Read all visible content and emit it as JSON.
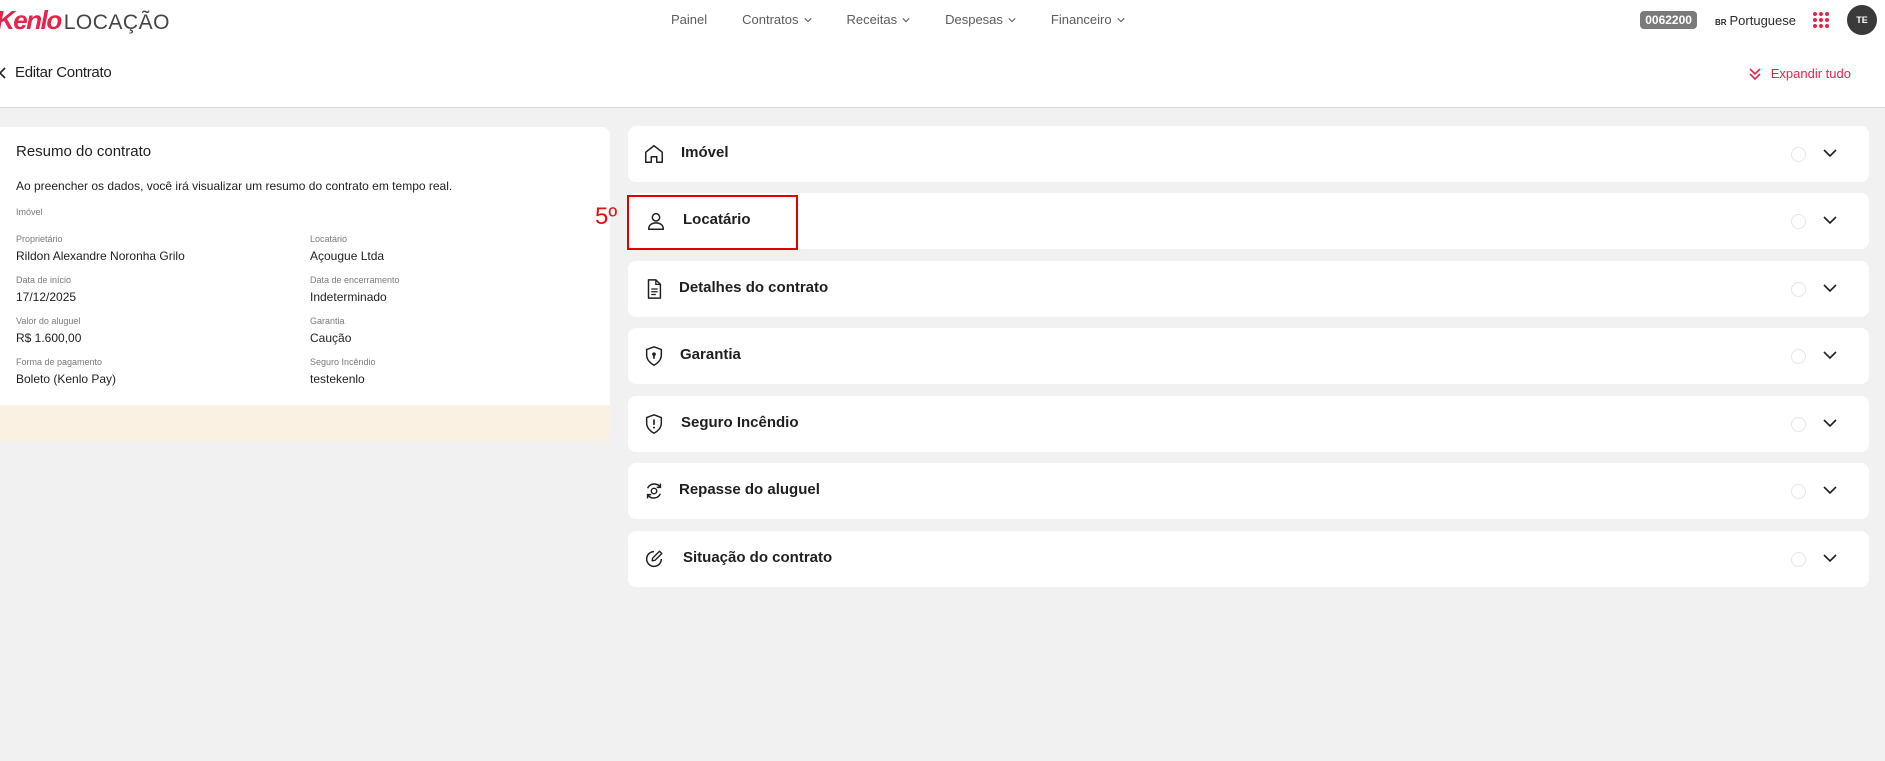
{
  "nav": {
    "logo_brand": "Kenlo",
    "logo_product": "LOCAÇÃO",
    "menu": [
      {
        "label": "Painel",
        "dropdown": false
      },
      {
        "label": "Contratos",
        "dropdown": true
      },
      {
        "label": "Receitas",
        "dropdown": true
      },
      {
        "label": "Despesas",
        "dropdown": true
      },
      {
        "label": "Financeiro",
        "dropdown": true
      }
    ],
    "code": "0062200",
    "lang_code": "BR",
    "lang": "Portuguese",
    "avatar": "TE"
  },
  "header": {
    "title": "Editar Contrato",
    "expand": "Expandir tudo"
  },
  "summary": {
    "title": "Resumo do contrato",
    "desc": "Ao preencher os dados, você irá visualizar um resumo do contrato em tempo real.",
    "imovel_label": "Imóvel",
    "fields": [
      {
        "label": "Proprietário",
        "value": "Rildon Alexandre Noronha Grilo"
      },
      {
        "label": "Locatário",
        "value": "Açougue Ltda"
      },
      {
        "label": "Data de início",
        "value": "17/12/2025"
      },
      {
        "label": "Data de encerramento",
        "value": "Indeterminado"
      },
      {
        "label": "Valor do aluguel",
        "value": "R$ 1.600,00"
      },
      {
        "label": "Garantia",
        "value": "Caução"
      },
      {
        "label": "Forma de pagamento",
        "value": "Boleto (Kenlo Pay)"
      },
      {
        "label": "Seguro Incêndio",
        "value": "testekenlo"
      }
    ]
  },
  "sections": [
    {
      "label": "Imóvel",
      "icon": "home-icon"
    },
    {
      "label": "Locatário",
      "icon": "user-icon"
    },
    {
      "label": "Detalhes do contrato",
      "icon": "document-icon"
    },
    {
      "label": "Garantia",
      "icon": "shield-lock-icon"
    },
    {
      "label": "Seguro Incêndio",
      "icon": "shield-alert-icon"
    },
    {
      "label": "Repasse do aluguel",
      "icon": "transfer-icon"
    },
    {
      "label": "Situação do contrato",
      "icon": "edit-circle-icon"
    }
  ],
  "annotation": {
    "label": "5º"
  },
  "colors": {
    "accent": "#e4254b",
    "annotation": "#e00000",
    "summary_footer": "#faf1e3"
  }
}
